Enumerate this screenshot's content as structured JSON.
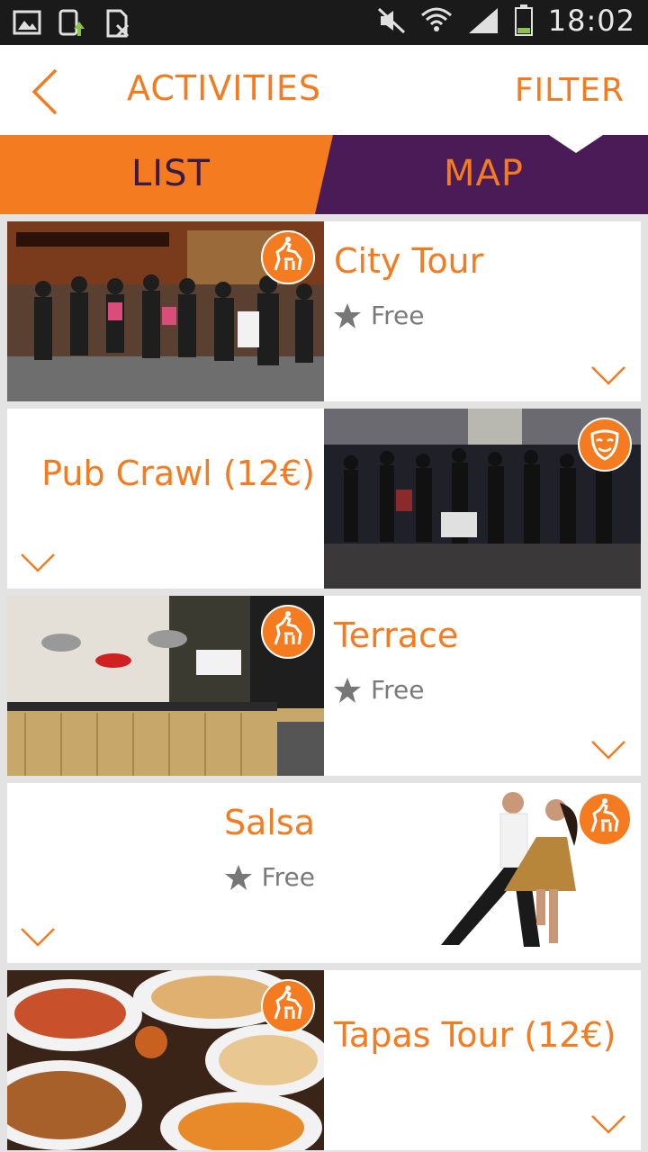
{
  "status_bar": {
    "time": "18:02"
  },
  "header": {
    "title": "ACTIVITIES",
    "filter_label": "FILTER"
  },
  "tabs": [
    {
      "label": "LIST"
    },
    {
      "label": "MAP"
    }
  ],
  "activities": [
    {
      "title": "City Tour",
      "price": "Free",
      "badge": "horse-rider-icon"
    },
    {
      "title": "Pub Crawl (12€)",
      "price": "",
      "badge": "theater-mask-icon"
    },
    {
      "title": "Terrace",
      "price": "Free",
      "badge": "horse-rider-icon"
    },
    {
      "title": "Salsa",
      "price": "Free",
      "badge": "horse-rider-icon"
    },
    {
      "title": "Tapas Tour (12€)",
      "price": "",
      "badge": "horse-rider-icon"
    }
  ],
  "colors": {
    "accent": "#f47b20",
    "tab_inactive": "#4a1b56",
    "price_text": "#7a7a7a"
  }
}
